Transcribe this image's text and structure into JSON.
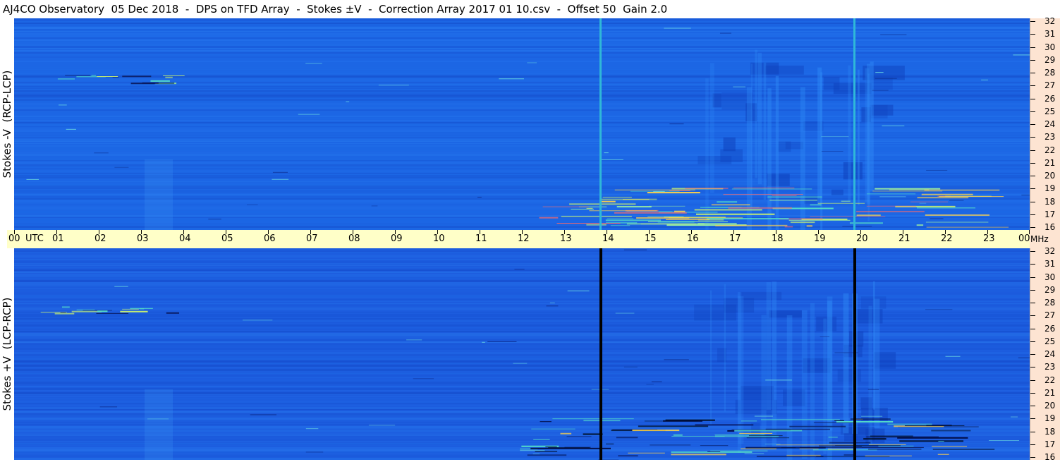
{
  "title": "AJ4CO Observatory  05 Dec 2018  -  DPS on TFD Array  -  Stokes ±V  -  Correction Array 2017 01 10.csv  -  Offset 50  Gain 2.0",
  "panels": [
    {
      "label": "Stokes -V  (RCP-LCP)",
      "background": "#1c66e4",
      "vertical_lines": [
        "#2fb8d8",
        "#2fb8d8"
      ]
    },
    {
      "label": "Stokes +V  (LCP-RCP)",
      "background": "#1c5cde",
      "vertical_lines": [
        "#000000",
        "#000000"
      ]
    }
  ],
  "freq_axis": {
    "unit": "MHz",
    "labels": [
      "32",
      "31",
      "30",
      "29",
      "28",
      "27",
      "26",
      "25",
      "24",
      "23",
      "22",
      "21",
      "20",
      "19",
      "18",
      "17",
      "16"
    ]
  },
  "time_axis": {
    "start_label": "00",
    "utc_label": "UTC",
    "hour_labels": [
      "01",
      "02",
      "03",
      "04",
      "05",
      "06",
      "07",
      "08",
      "09",
      "10",
      "11",
      "12",
      "13",
      "14",
      "15",
      "16",
      "17",
      "18",
      "19",
      "20",
      "21",
      "22",
      "23"
    ],
    "end_label": "00",
    "unit_label": "MHz"
  },
  "colors": {
    "timebar": "#ffffc8",
    "freqbar": "#fde4d2",
    "spectrum_base": "#1a62e0",
    "burst_hot": "#ffd24a",
    "burst_cool": "#55e0c8"
  }
}
